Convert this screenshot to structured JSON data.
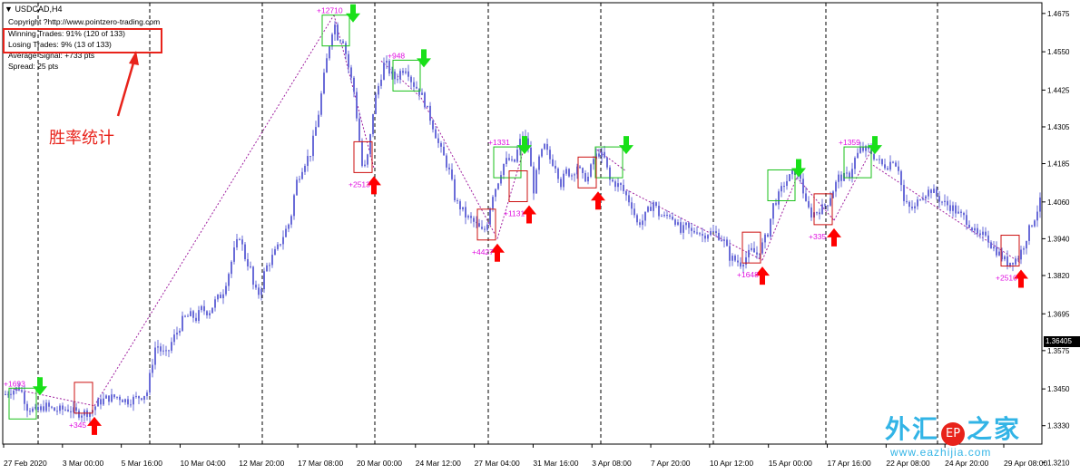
{
  "header": {
    "symbol": "USDCAD,H4",
    "copyright": "Copyright ?http://www.pointzero-trading.com",
    "winning": "Winning Trades: 91% (120 of 133)",
    "losing": "Losing Trades: 9% (13 of 133)",
    "avg_signal": "Average Signal: +733 pts",
    "spread": "Spread: 25 pts"
  },
  "annotation": "胜率统计",
  "watermark": {
    "title_left": "外汇",
    "badge": "EP",
    "title_right": "之家",
    "url": "www.eazhijia.com"
  },
  "colors": {
    "candle": "#6a6cd8",
    "buy_arrow": "#ff0000",
    "sell_arrow": "#19e019",
    "profit_label": "#e010e0",
    "stats_box": "#e8231b",
    "grid": "#000000"
  },
  "chart_data": {
    "type": "candlestick",
    "symbol": "USDCAD",
    "timeframe": "H4",
    "current_price": "1.36405",
    "ylim": [
      1.327,
      1.471
    ],
    "y_ticks": [
      "1.4675",
      "1.4550",
      "1.4425",
      "1.4305",
      "1.4185",
      "1.4060",
      "1.3940",
      "1.3820",
      "1.3695",
      "1.3575",
      "1.3450",
      "1.3330",
      "1.3210"
    ],
    "x_ticks": [
      "27 Feb 2020",
      "3 Mar 00:00",
      "5 Mar 16:00",
      "10 Mar 04:00",
      "12 Mar 20:00",
      "17 Mar 08:00",
      "20 Mar 00:00",
      "24 Mar 12:00",
      "27 Mar 04:00",
      "31 Mar 16:00",
      "3 Apr 08:00",
      "7 Apr 20:00",
      "10 Apr 12:00",
      "15 Apr 00:00",
      "17 Apr 16:00",
      "22 Apr 08:00",
      "24 Apr 20:00",
      "29 Apr 08:00"
    ],
    "close_path": [
      [
        0,
        1.341
      ],
      [
        8,
        1.344
      ],
      [
        16,
        1.3448
      ],
      [
        22,
        1.3455
      ],
      [
        30,
        1.339
      ],
      [
        40,
        1.3375
      ],
      [
        50,
        1.3395
      ],
      [
        60,
        1.338
      ],
      [
        75,
        1.3385
      ],
      [
        85,
        1.337
      ],
      [
        100,
        1.3375
      ],
      [
        108,
        1.3405
      ],
      [
        118,
        1.342
      ],
      [
        130,
        1.3425
      ],
      [
        140,
        1.341
      ],
      [
        150,
        1.342
      ],
      [
        158,
        1.343
      ],
      [
        162,
        1.344
      ],
      [
        168,
        1.354
      ],
      [
        172,
        1.36
      ],
      [
        178,
        1.357
      ],
      [
        184,
        1.356
      ],
      [
        190,
        1.361
      ],
      [
        196,
        1.364
      ],
      [
        202,
        1.368
      ],
      [
        210,
        1.369
      ],
      [
        216,
        1.368
      ],
      [
        222,
        1.371
      ],
      [
        230,
        1.37
      ],
      [
        238,
        1.374
      ],
      [
        245,
        1.376
      ],
      [
        252,
        1.383
      ],
      [
        258,
        1.39
      ],
      [
        264,
        1.395
      ],
      [
        270,
        1.388
      ],
      [
        276,
        1.384
      ],
      [
        280,
        1.377
      ],
      [
        286,
        1.376
      ],
      [
        292,
        1.384
      ],
      [
        300,
        1.388
      ],
      [
        306,
        1.391
      ],
      [
        312,
        1.395
      ],
      [
        320,
        1.4
      ],
      [
        326,
        1.412
      ],
      [
        334,
        1.418
      ],
      [
        342,
        1.422
      ],
      [
        350,
        1.433
      ],
      [
        356,
        1.445
      ],
      [
        362,
        1.456
      ],
      [
        368,
        1.465
      ],
      [
        372,
        1.46
      ],
      [
        378,
        1.459
      ],
      [
        384,
        1.45
      ],
      [
        390,
        1.442
      ],
      [
        396,
        1.426
      ],
      [
        400,
        1.415
      ],
      [
        406,
        1.422
      ],
      [
        412,
        1.438
      ],
      [
        418,
        1.445
      ],
      [
        424,
        1.452
      ],
      [
        430,
        1.448
      ],
      [
        436,
        1.446
      ],
      [
        442,
        1.449
      ],
      [
        448,
        1.45
      ],
      [
        454,
        1.445
      ],
      [
        460,
        1.443
      ],
      [
        466,
        1.44
      ],
      [
        472,
        1.435
      ],
      [
        478,
        1.43
      ],
      [
        484,
        1.424
      ],
      [
        490,
        1.42
      ],
      [
        496,
        1.415
      ],
      [
        502,
        1.406
      ],
      [
        508,
        1.404
      ],
      [
        514,
        1.401
      ],
      [
        520,
        1.4
      ],
      [
        526,
        1.398
      ],
      [
        532,
        1.396
      ],
      [
        536,
        1.398
      ],
      [
        542,
        1.408
      ],
      [
        548,
        1.412
      ],
      [
        554,
        1.418
      ],
      [
        560,
        1.42
      ],
      [
        566,
        1.418
      ],
      [
        572,
        1.425
      ],
      [
        576,
        1.428
      ],
      [
        582,
        1.424
      ],
      [
        588,
        1.41
      ],
      [
        594,
        1.42
      ],
      [
        600,
        1.424
      ],
      [
        606,
        1.42
      ],
      [
        612,
        1.418
      ],
      [
        618,
        1.412
      ],
      [
        624,
        1.416
      ],
      [
        630,
        1.415
      ],
      [
        636,
        1.418
      ],
      [
        642,
        1.414
      ],
      [
        648,
        1.414
      ],
      [
        654,
        1.42
      ],
      [
        660,
        1.422
      ],
      [
        666,
        1.42
      ],
      [
        672,
        1.413
      ],
      [
        678,
        1.412
      ],
      [
        684,
        1.411
      ],
      [
        690,
        1.408
      ],
      [
        696,
        1.405
      ],
      [
        702,
        1.399
      ],
      [
        708,
        1.4
      ],
      [
        714,
        1.403
      ],
      [
        720,
        1.406
      ],
      [
        726,
        1.402
      ],
      [
        732,
        1.401
      ],
      [
        738,
        1.402
      ],
      [
        744,
        1.4
      ],
      [
        750,
        1.396
      ],
      [
        756,
        1.398
      ],
      [
        762,
        1.396
      ],
      [
        768,
        1.397
      ],
      [
        774,
        1.395
      ],
      [
        780,
        1.396
      ],
      [
        786,
        1.396
      ],
      [
        792,
        1.395
      ],
      [
        798,
        1.393
      ],
      [
        804,
        1.388
      ],
      [
        810,
        1.387
      ],
      [
        816,
        1.386
      ],
      [
        822,
        1.388
      ],
      [
        828,
        1.39
      ],
      [
        834,
        1.389
      ],
      [
        840,
        1.392
      ],
      [
        846,
        1.396
      ],
      [
        852,
        1.405
      ],
      [
        858,
        1.408
      ],
      [
        864,
        1.412
      ],
      [
        870,
        1.414
      ],
      [
        876,
        1.416
      ],
      [
        882,
        1.414
      ],
      [
        888,
        1.405
      ],
      [
        894,
        1.402
      ],
      [
        900,
        1.403
      ],
      [
        906,
        1.404
      ],
      [
        912,
        1.406
      ],
      [
        918,
        1.41
      ],
      [
        924,
        1.414
      ],
      [
        930,
        1.414
      ],
      [
        936,
        1.415
      ],
      [
        942,
        1.42
      ],
      [
        948,
        1.423
      ],
      [
        954,
        1.423
      ],
      [
        960,
        1.422
      ],
      [
        966,
        1.42
      ],
      [
        972,
        1.418
      ],
      [
        978,
        1.418
      ],
      [
        984,
        1.42
      ],
      [
        990,
        1.417
      ],
      [
        996,
        1.406
      ],
      [
        1002,
        1.404
      ],
      [
        1008,
        1.404
      ],
      [
        1014,
        1.408
      ],
      [
        1020,
        1.409
      ],
      [
        1026,
        1.41
      ],
      [
        1032,
        1.408
      ],
      [
        1038,
        1.406
      ],
      [
        1044,
        1.405
      ],
      [
        1050,
        1.404
      ],
      [
        1056,
        1.402
      ],
      [
        1062,
        1.401
      ],
      [
        1068,
        1.399
      ],
      [
        1074,
        1.396
      ],
      [
        1080,
        1.394
      ],
      [
        1086,
        1.396
      ],
      [
        1092,
        1.392
      ],
      [
        1098,
        1.39
      ],
      [
        1104,
        1.388
      ],
      [
        1110,
        1.386
      ],
      [
        1116,
        1.387
      ],
      [
        1122,
        1.388
      ],
      [
        1128,
        1.392
      ],
      [
        1134,
        1.397
      ],
      [
        1140,
        1.401
      ],
      [
        1146,
        1.406
      ]
    ],
    "signals": [
      {
        "type": "sell",
        "label": "+1693",
        "x": 44,
        "price": 1.3488
      },
      {
        "type": "buy",
        "label": "+345",
        "x": 104,
        "price": 1.3365
      },
      {
        "type": "sell",
        "label": "+12710",
        "x": 389,
        "price": 1.4705
      },
      {
        "type": "buy",
        "label": "+2513",
        "x": 412,
        "price": 1.415
      },
      {
        "type": "sell",
        "label": "+948",
        "x": 467,
        "price": 1.4558
      },
      {
        "type": "buy",
        "label": "+4427",
        "x": 548,
        "price": 1.393
      },
      {
        "type": "sell",
        "label": "+1331",
        "x": 578,
        "price": 1.4275
      },
      {
        "type": "buy",
        "label": "+1131",
        "x": 583,
        "price": 1.4055
      },
      {
        "type": "sell",
        "label": "",
        "x": 690,
        "price": 1.4275
      },
      {
        "type": "buy",
        "label": "",
        "x": 659,
        "price": 1.41
      },
      {
        "type": "buy",
        "label": "+1648",
        "x": 840,
        "price": 1.3855
      },
      {
        "type": "sell",
        "label": "",
        "x": 880,
        "price": 1.42
      },
      {
        "type": "buy",
        "label": "+335",
        "x": 919,
        "price": 1.398
      },
      {
        "type": "sell",
        "label": "+1359",
        "x": 964,
        "price": 1.4275
      },
      {
        "type": "buy",
        "label": "+2510",
        "x": 1125,
        "price": 1.3845
      }
    ],
    "trade_lines": [
      [
        [
          15,
          1.345
        ],
        [
          104,
          1.3395
        ]
      ],
      [
        [
          104,
          1.3395
        ],
        [
          368,
          1.467
        ]
      ],
      [
        [
          368,
          1.467
        ],
        [
          412,
          1.417
        ]
      ],
      [
        [
          420,
          1.452
        ],
        [
          464,
          1.44
        ]
      ],
      [
        [
          464,
          1.44
        ],
        [
          548,
          1.394
        ]
      ],
      [
        [
          548,
          1.394
        ],
        [
          578,
          1.424
        ]
      ],
      [
        [
          658,
          1.423
        ],
        [
          690,
          1.416
        ]
      ],
      [
        [
          690,
          1.41
        ],
        [
          840,
          1.387
        ]
      ],
      [
        [
          840,
          1.387
        ],
        [
          878,
          1.414
        ]
      ],
      [
        [
          878,
          1.414
        ],
        [
          919,
          1.4
        ]
      ],
      [
        [
          919,
          1.4
        ],
        [
          962,
          1.424
        ]
      ],
      [
        [
          962,
          1.418
        ],
        [
          1125,
          1.386
        ]
      ]
    ]
  }
}
